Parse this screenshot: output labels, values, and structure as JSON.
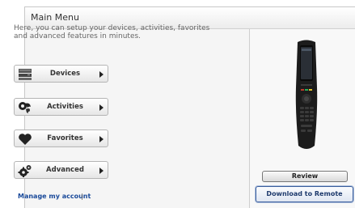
{
  "header": {
    "title": "Main Menu"
  },
  "intro_text": "Here, you can setup your devices, activities, favorites and advanced features in minutes.",
  "menu": {
    "devices": {
      "label": "Devices",
      "icon": "device-stack-icon"
    },
    "activities": {
      "label": "Activities",
      "icon": "activities-icon"
    },
    "favorites": {
      "label": "Favorites",
      "icon": "heart-icon"
    },
    "advanced": {
      "label": "Advanced",
      "icon": "gears-icon"
    }
  },
  "footer": {
    "manage_account_label": "Manage my account",
    "separator": "|"
  },
  "right_panel": {
    "review_label": "Review",
    "download_label": "Download to Remote",
    "image": "universal-remote"
  },
  "colors": {
    "link": "#1a4a9a",
    "download_border": "#3b5f9e",
    "remote_accent_red": "#c0392b",
    "remote_accent_green": "#27ae60"
  }
}
